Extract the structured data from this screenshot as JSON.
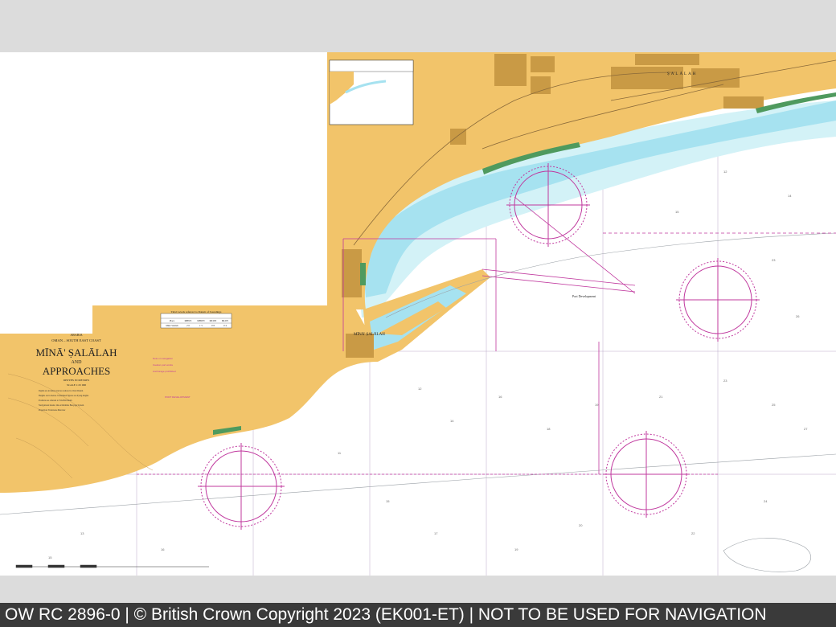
{
  "chart": {
    "region": "ARABIA",
    "coast": "OMAN – SOUTH EAST COAST",
    "title_line1": "MĪNĀ' ṢALĀLAH",
    "title_line2": "AND",
    "title_line3": "APPROACHES",
    "depths": "DEPTHS IN METRES",
    "scale": "SCALE 1:25 000"
  },
  "places": {
    "port": "MĪNĀ' ṢALĀLAH",
    "town": "ṢALĀLAH",
    "port_development": "Port Development"
  },
  "tide_table": {
    "title": "Tidal Levels referred to Datum of Soundings",
    "headers": [
      "Place",
      "MHWS",
      "MHWN",
      "MLWN",
      "MLWS"
    ],
    "rows": [
      [
        "Mina' Salalah",
        "2·0",
        "1·5",
        "0·8",
        "0·4"
      ]
    ]
  },
  "footer": {
    "text": "OW RC 2896-0 | © British Crown Copyright 2023 (EK001-ET) | NOT TO BE USED FOR NAVIGATION"
  },
  "colors": {
    "land": "#f2c46a",
    "urban": "#c99a45",
    "shallow": "#a6e2f0",
    "mid": "#d3f2f7",
    "sea": "#ffffff",
    "intertidal": "#4f9a5e",
    "magenta": "#c0389e"
  }
}
